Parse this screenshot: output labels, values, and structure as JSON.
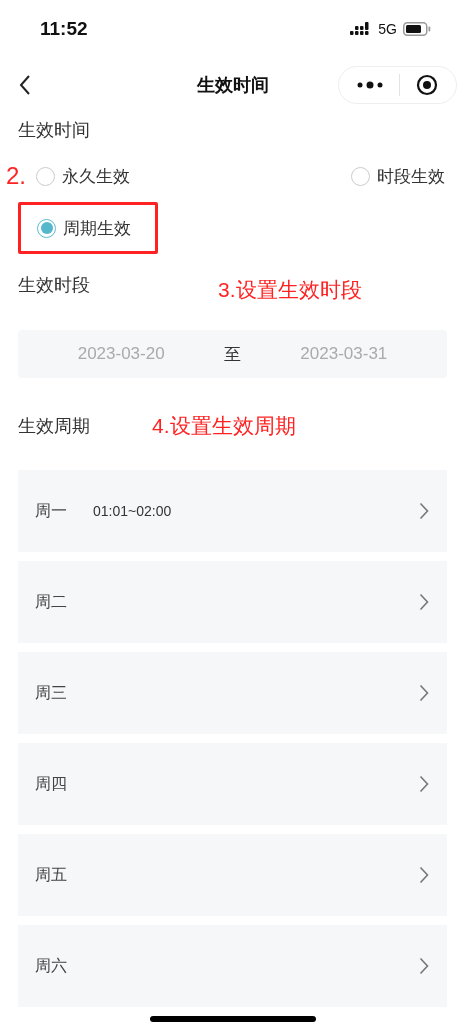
{
  "status_bar": {
    "time": "11:52",
    "network": "5G"
  },
  "nav": {
    "title": "生效时间"
  },
  "effective_time": {
    "label": "生效时间",
    "step_note": "2.",
    "options": [
      {
        "label": "永久生效",
        "selected": false,
        "highlighted": false
      },
      {
        "label": "时段生效",
        "selected": false,
        "highlighted": false
      },
      {
        "label": "周期生效",
        "selected": true,
        "highlighted": true
      }
    ]
  },
  "period": {
    "label": "生效时段",
    "step_note": "3.设置生效时段",
    "start": "2023-03-20",
    "separator": "至",
    "end": "2023-03-31"
  },
  "cycle": {
    "label": "生效周期",
    "step_note": "4.设置生效周期",
    "days": [
      {
        "day": "周一",
        "time": "01:01~02:00"
      },
      {
        "day": "周二"
      },
      {
        "day": "周三"
      },
      {
        "day": "周四"
      },
      {
        "day": "周五"
      },
      {
        "day": "周六"
      }
    ]
  }
}
